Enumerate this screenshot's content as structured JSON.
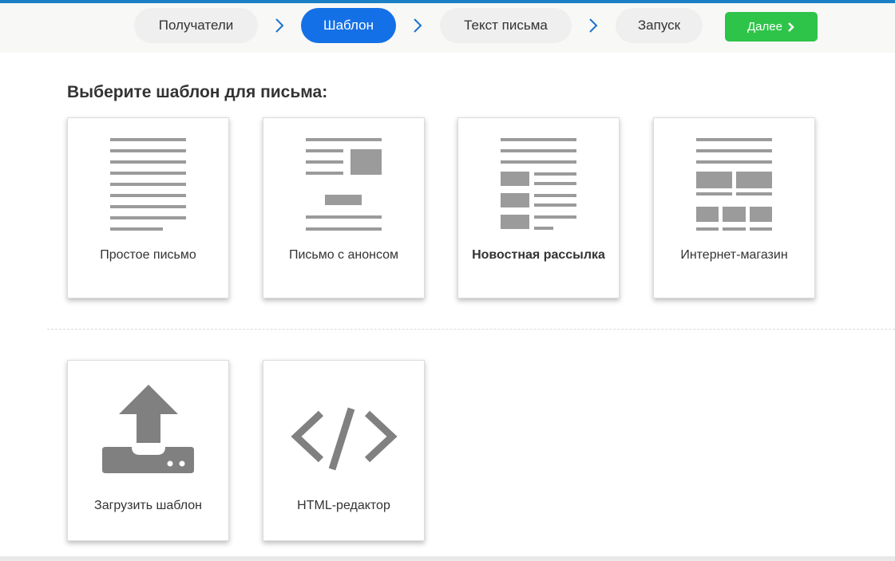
{
  "wizard": {
    "steps": [
      {
        "label": "Получатели",
        "active": false
      },
      {
        "label": "Шаблон",
        "active": true
      },
      {
        "label": "Текст письма",
        "active": false
      },
      {
        "label": "Запуск",
        "active": false
      }
    ],
    "next_label": "Далее",
    "colors": {
      "active": "#1470e6",
      "next": "#2ec44a",
      "chevron": "#1a73c9",
      "topline": "#1a7fc4"
    }
  },
  "main": {
    "title": "Выберите шаблон для письма:",
    "templates": [
      {
        "label": "Простое письмо",
        "icon": "plain-letter-icon"
      },
      {
        "label": "Письмо с анонсом",
        "icon": "announcement-letter-icon"
      },
      {
        "label": "Новостная рассылка",
        "icon": "newsletter-icon",
        "selected": true
      },
      {
        "label": "Интернет-магазин",
        "icon": "online-store-icon"
      }
    ],
    "custom": [
      {
        "label": "Загрузить шаблон",
        "icon": "upload-icon"
      },
      {
        "label": "HTML-редактор",
        "icon": "code-icon"
      }
    ]
  }
}
